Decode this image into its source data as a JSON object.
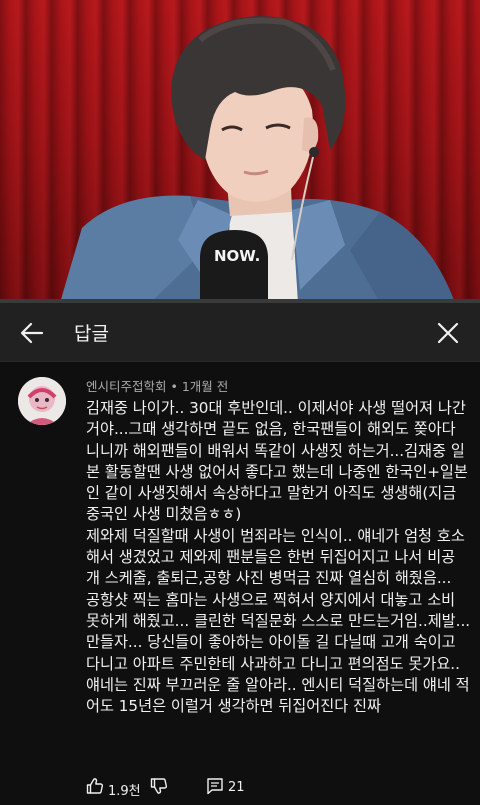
{
  "video": {
    "mic_brand": "NOW.",
    "progress_fraction": 0.0
  },
  "header": {
    "title": "답글",
    "back_icon": "arrow-back-icon",
    "close_icon": "close-icon"
  },
  "comment": {
    "author": "엔시티주접학회",
    "separator": "•",
    "time": "1개월 전",
    "lines": [
      "김재중 나이가.. 30대 후반인데.. 이제서야 사생 떨어져 나간",
      "거야...그때 생각하면 끝도 없음,  한국팬들이 해외도 쫒아다",
      "니니까 해외팬들이 배워서 똑같이 사생짓 하는거...김재중 일",
      "본 활동할땐 사생 없어서 좋다고 했는데 나중엔 한국인+일본",
      "인 같이 사생짓해서 속상하다고 말한거 아직도 생생해(지금",
      "중국인 사생 미쳤음ㅎㅎ)",
      "제와제 덕질할때 사생이 범죄라는 인식이.. 얘네가 엄청 호소",
      "해서 생겼었고 제와제 팬분들은 한번 뒤집어지고 나서 비공",
      "개 스케줄, 출퇴근,공항 사진 병먹금 진짜 열심히 해줬음...",
      "공항샷 찍는 홈마는 사생으로 찍혀서 양지에서 대놓고 소비",
      "못하게 해줬고... 클린한 덕질문화 스스로 만드는거임..제발...",
      "만들자... 당신들이 좋아하는 아이돌 길 다닐때 고개 숙이고",
      "다니고 아파트 주민한테 사과하고 다니고 편의점도 못가요..",
      "얘네는 진짜 부끄러운 줄 알아라.. 엔시티 덕질하는데 얘네 적",
      "어도 15년은 이럴거 생각하면 뒤집어진다 진짜"
    ],
    "likes": "1.9천",
    "replies": "21",
    "like_icon": "thumbs-up-icon",
    "dislike_icon": "thumbs-down-icon",
    "reply_icon": "comment-icon"
  }
}
